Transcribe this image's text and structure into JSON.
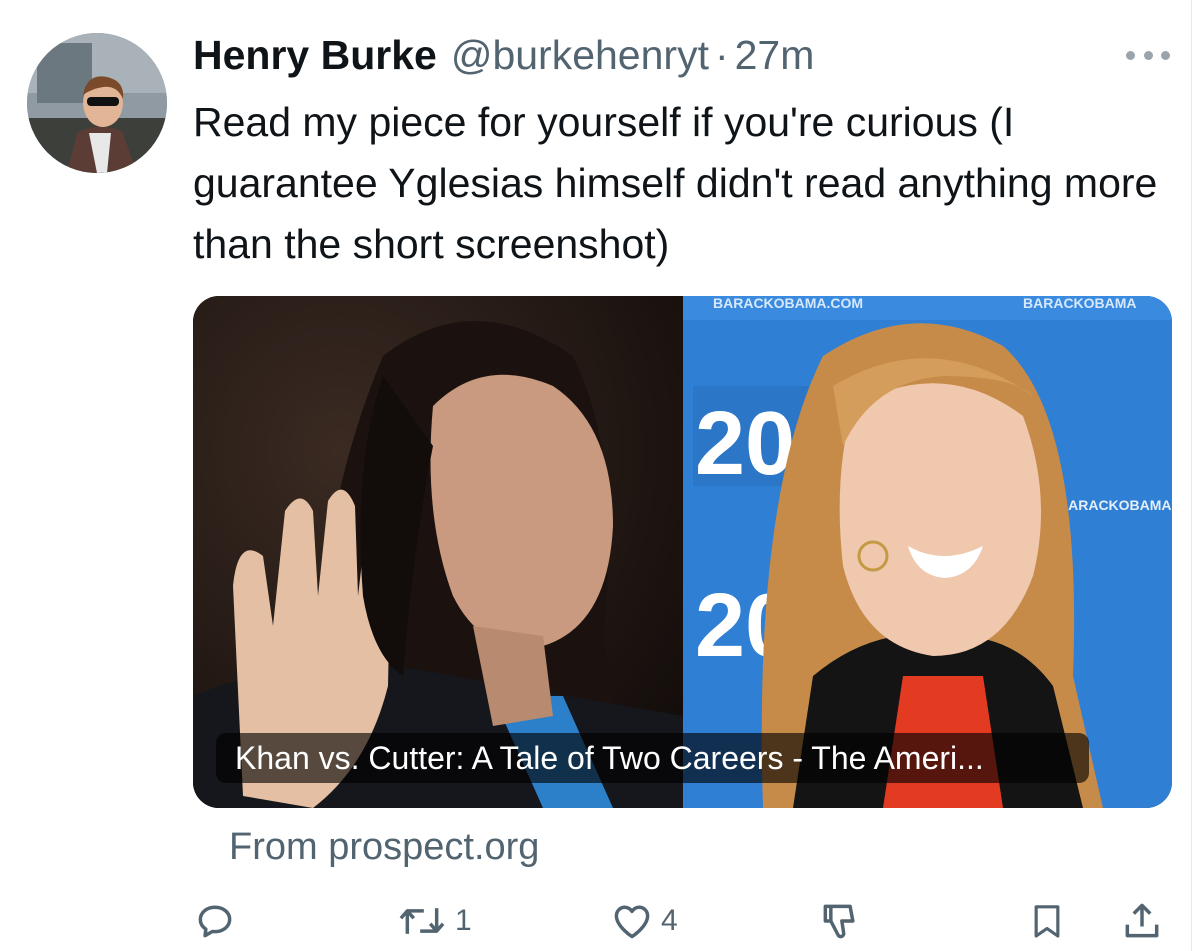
{
  "tweet": {
    "display_name": "Henry Burke",
    "handle": "@burkehenryt",
    "separator": "·",
    "time": "27m",
    "text": "Read my piece for yourself if you're curious (I guarantee Yglesias himself didn't read anything more than the short screenshot)"
  },
  "card": {
    "title": "Khan vs. Cutter: A Tale of Two Careers - The Ameri...",
    "source": "From prospect.org",
    "backdrop_texts": [
      "BARACKOBAMA.COM",
      "BARACKOBAMA",
      "2012",
      "BARACKOBAMA"
    ]
  },
  "actions": {
    "reply_count": "",
    "retweet_count": "1",
    "like_count": "4"
  },
  "icons": {
    "more": "more-horizontal-icon",
    "reply": "reply-icon",
    "retweet": "retweet-icon",
    "like": "heart-icon",
    "dislike": "downvote-icon",
    "bookmark": "bookmark-icon",
    "share": "share-icon"
  },
  "colors": {
    "text": "#0f1419",
    "secondary": "#536471",
    "backdrop_blue": "#2f7fd4"
  }
}
